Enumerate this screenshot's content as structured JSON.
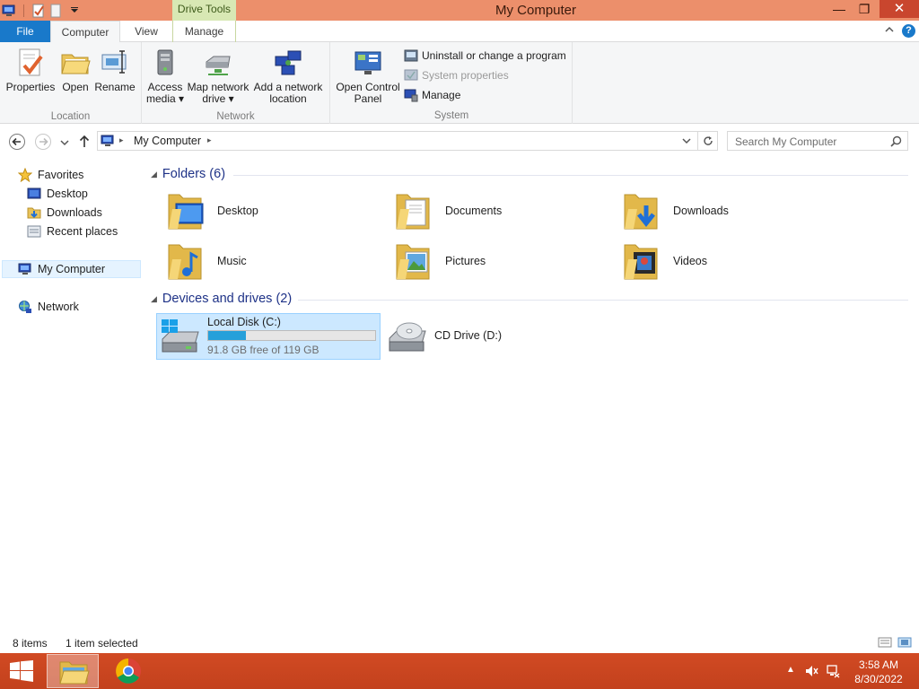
{
  "window": {
    "title": "My Computer",
    "context_tab": "Drive Tools",
    "minimize": "—",
    "restore": "❐",
    "close": "✕"
  },
  "tabs": {
    "file": "File",
    "computer": "Computer",
    "view": "View",
    "manage": "Manage"
  },
  "ribbon": {
    "location": {
      "label": "Location",
      "properties": "Properties",
      "open": "Open",
      "rename": "Rename"
    },
    "network": {
      "label": "Network",
      "access_media": [
        "Access",
        "media ▾"
      ],
      "map_drive": [
        "Map network",
        "drive ▾"
      ],
      "add_location": [
        "Add a network",
        "location"
      ]
    },
    "system": {
      "label": "System",
      "control_panel": [
        "Open Control",
        "Panel"
      ],
      "uninstall": "Uninstall or change a program",
      "system_properties": "System properties",
      "manage": "Manage"
    }
  },
  "address": {
    "crumb": "My Computer",
    "search_placeholder": "Search My Computer"
  },
  "navpane": {
    "favorites": "Favorites",
    "desktop": "Desktop",
    "downloads": "Downloads",
    "recent": "Recent places",
    "my_computer": "My Computer",
    "network": "Network"
  },
  "sections": {
    "folders": "Folders (6)",
    "devices": "Devices and drives (2)"
  },
  "folders": [
    "Desktop",
    "Documents",
    "Downloads",
    "Music",
    "Pictures",
    "Videos"
  ],
  "drives": {
    "c": {
      "name": "Local Disk (C:)",
      "free": "91.8 GB free of 119 GB",
      "used_fraction": 0.228
    },
    "d": {
      "name": "CD Drive (D:)"
    }
  },
  "status": {
    "items": "8 items",
    "selected": "1 item selected"
  },
  "clock": {
    "time": "3:58 AM",
    "date": "8/30/2022"
  },
  "colors": {
    "accent": "#1979ca",
    "titlebar": "#ec8f6b",
    "taskbar": "#c3411d",
    "context": "#d8e8b4"
  }
}
